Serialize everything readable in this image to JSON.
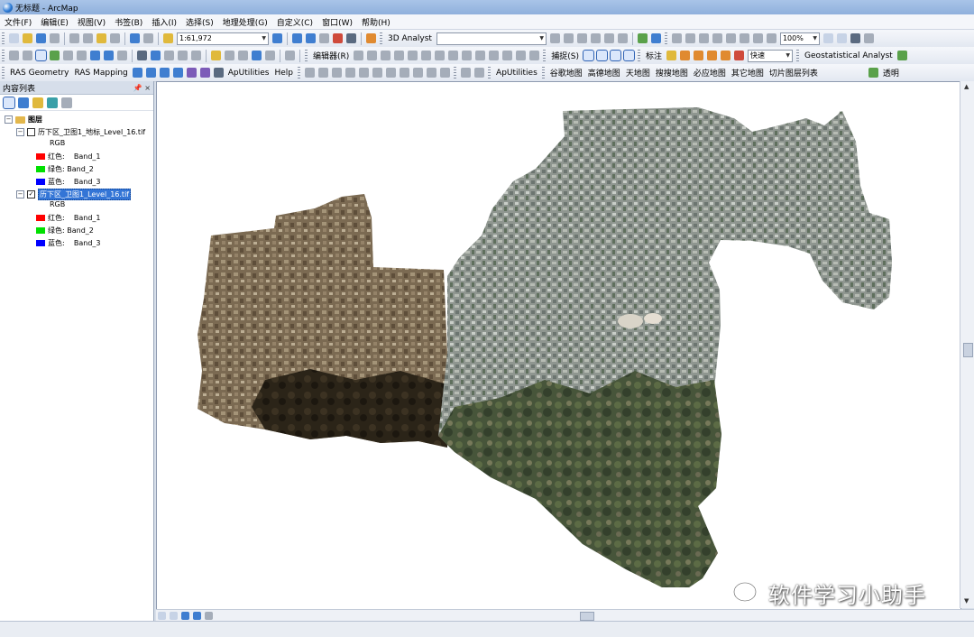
{
  "window": {
    "title": "无标题 - ArcMap"
  },
  "menu": [
    "文件(F)",
    "编辑(E)",
    "视图(V)",
    "书签(B)",
    "插入(I)",
    "选择(S)",
    "地理处理(G)",
    "自定义(C)",
    "窗口(W)",
    "帮助(H)"
  ],
  "toolbar1": {
    "scale_value": "1:61,972",
    "analyst_3d": "3D Analyst",
    "zoom_value": "100%"
  },
  "toolbar2": {
    "editor_label": "编辑器(R)",
    "snapping_label": "捕捉(S)",
    "label_menu": "标注",
    "speed_value": "快速",
    "geostatistical": "Geostatistical Analyst"
  },
  "toolbar3": {
    "ras_geometry": "RAS Geometry",
    "ras_mapping": "RAS Mapping",
    "ap_utilities": "ApUtilities",
    "help": "Help",
    "ap_utilities2": "ApUtilities",
    "map_google": "谷歌地图",
    "map_gaode": "高德地图",
    "map_tianditu": "天地图",
    "map_sogou": "搜搜地图",
    "map_bing": "必应地图",
    "map_other": "其它地图",
    "tile_list": "切片图层列表",
    "transparency": "透明"
  },
  "toc": {
    "title": "内容列表",
    "pin": "📌 ×",
    "root": "图层",
    "layers": [
      {
        "name": "历下区_卫图1_地标_Level_16.tif",
        "checked": false,
        "rgb": "RGB",
        "bands": [
          {
            "label": "红色:",
            "band": "Band_1",
            "color": "#ff0000"
          },
          {
            "label": "绿色:",
            "band": "Band_2",
            "color": "#00e000"
          },
          {
            "label": "蓝色:",
            "band": "Band_3",
            "color": "#0000ff"
          }
        ]
      },
      {
        "name": "历下区_卫图1_Level_16.tif",
        "checked": true,
        "rgb": "RGB",
        "bands": [
          {
            "label": "红色:",
            "band": "Band_1",
            "color": "#ff0000"
          },
          {
            "label": "绿色:",
            "band": "Band_2",
            "color": "#00e000"
          },
          {
            "label": "蓝色:",
            "band": "Band_3",
            "color": "#0000ff"
          }
        ]
      }
    ]
  },
  "watermark": {
    "text": "软件学习小助手"
  }
}
